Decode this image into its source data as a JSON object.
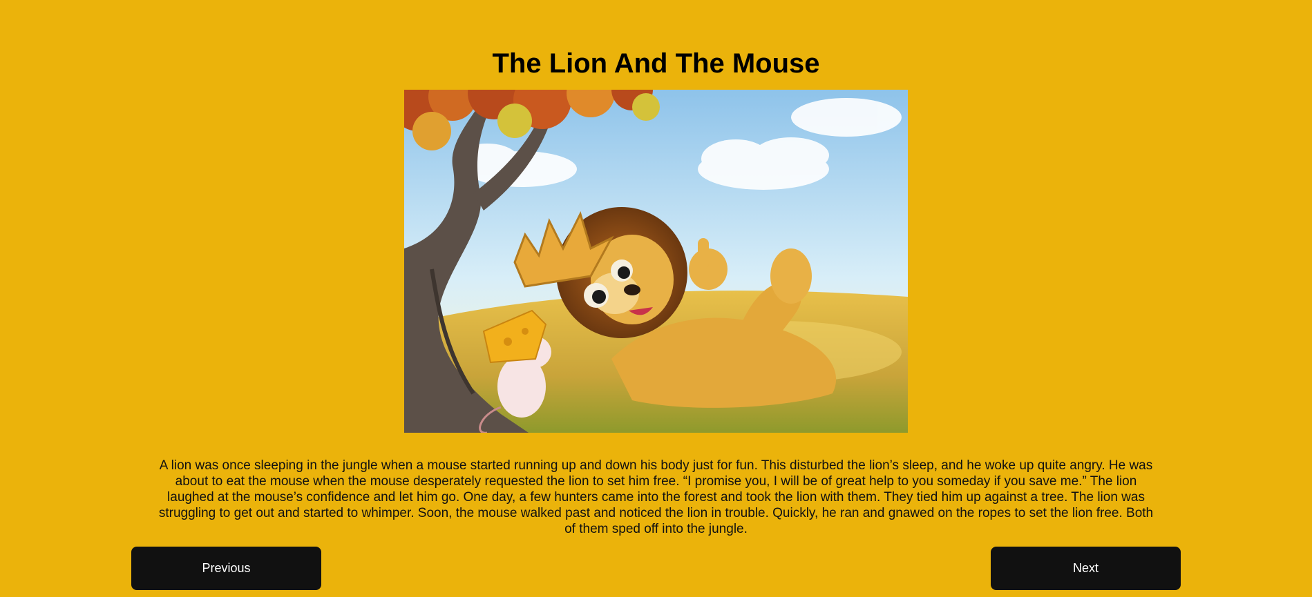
{
  "story": {
    "title": "The Lion And The Mouse",
    "text": "A lion was once sleeping in the jungle when a mouse started running up and down his body just for fun. This disturbed the lion’s sleep, and he woke up quite angry. He was about to eat the mouse when the mouse desperately requested the lion to set him free. “I promise you, I will be of great help to you someday if you save me.” The lion laughed at the mouse’s confidence and let him go. One day, a few hunters came into the forest and took the lion with them. They tied him up against a tree. The lion was struggling to get out and started to whimper. Soon, the mouse walked past and noticed the lion in trouble. Quickly, he ran and gnawed on the ropes to set the lion free. Both of them sped off into the jungle."
  },
  "navigation": {
    "previous_label": "Previous",
    "next_label": "Next"
  },
  "colors": {
    "background": "#ebb30b",
    "button": "#111111",
    "button_text": "#ffffff"
  }
}
